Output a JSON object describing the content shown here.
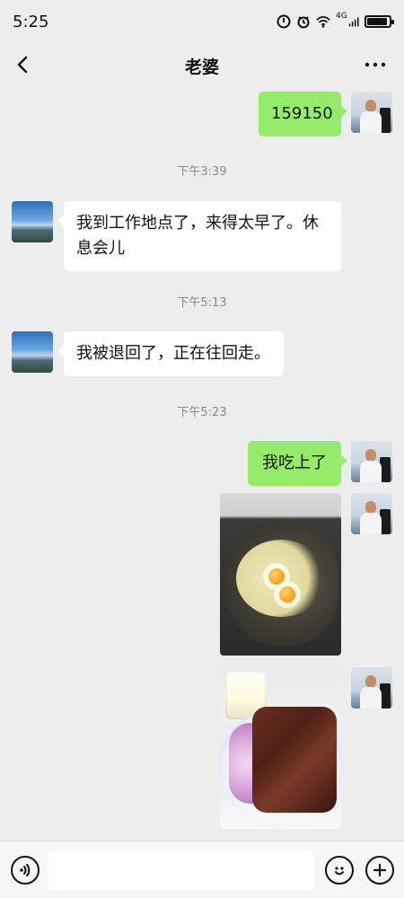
{
  "status_bar": {
    "time": "5:25",
    "network_label": "4G",
    "icons": [
      "do-not-disturb-icon",
      "alarm-icon",
      "wifi-icon",
      "signal-icon",
      "battery-icon"
    ]
  },
  "chat": {
    "title": "老婆",
    "messages": [
      {
        "type": "text",
        "direction": "out",
        "text": "159150"
      },
      {
        "type": "time",
        "text": "下午3:39"
      },
      {
        "type": "text",
        "direction": "in",
        "text": "我到工作地点了，来得太早了。休息会儿"
      },
      {
        "type": "time",
        "text": "下午5:13"
      },
      {
        "type": "text",
        "direction": "in",
        "text": "我被退回了，正在往回走。"
      },
      {
        "type": "time",
        "text": "下午5:23"
      },
      {
        "type": "text",
        "direction": "out",
        "text": "我吃上了"
      },
      {
        "type": "image",
        "direction": "out",
        "subject": "eggs-noodles-in-wok"
      },
      {
        "type": "image",
        "direction": "out",
        "subject": "braised-meat-plate-with-onion"
      }
    ]
  },
  "input": {
    "placeholder": "",
    "value": ""
  },
  "colors": {
    "background": "#ededed",
    "incoming_bubble": "#ffffff",
    "outgoing_bubble": "#95ec69",
    "timestamp_text": "#8a8a8a",
    "input_bar": "#f7f7f7"
  }
}
